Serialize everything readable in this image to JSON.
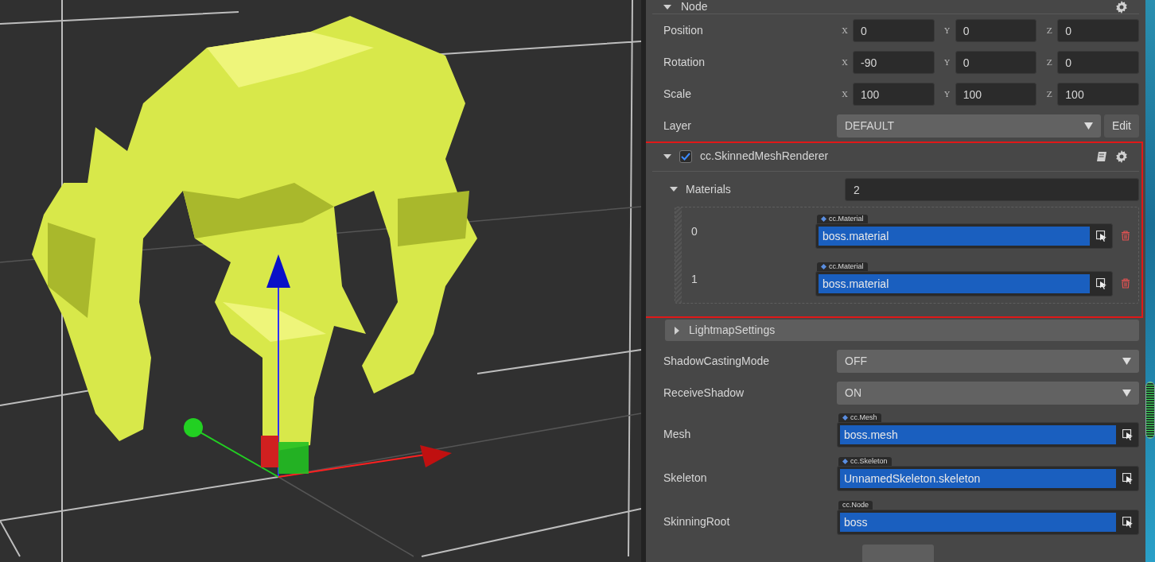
{
  "node": {
    "title": "Node",
    "expanded": true,
    "vectors": [
      {
        "label": "Position",
        "axes": [
          {
            "axis": "X",
            "value": "0"
          },
          {
            "axis": "Y",
            "value": "0"
          },
          {
            "axis": "Z",
            "value": "0"
          }
        ]
      },
      {
        "label": "Rotation",
        "axes": [
          {
            "axis": "X",
            "value": "-90"
          },
          {
            "axis": "Y",
            "value": "0"
          },
          {
            "axis": "Z",
            "value": "0"
          }
        ]
      },
      {
        "label": "Scale",
        "axes": [
          {
            "axis": "X",
            "value": "100"
          },
          {
            "axis": "Y",
            "value": "100"
          },
          {
            "axis": "Z",
            "value": "100"
          }
        ]
      }
    ],
    "layer": {
      "label": "Layer",
      "value": "DEFAULT",
      "button": "Edit"
    }
  },
  "component": {
    "title": "cc.SkinnedMeshRenderer",
    "enabled": true,
    "expanded": true,
    "highlighted": true,
    "materials": {
      "label": "Materials",
      "expanded": true,
      "count": "2",
      "items": [
        {
          "index": "0",
          "type": "cc.Material",
          "value": "boss.material"
        },
        {
          "index": "1",
          "type": "cc.Material",
          "value": "boss.material"
        }
      ]
    },
    "lightmap": {
      "label": "LightmapSettings",
      "expanded": false
    },
    "properties": [
      {
        "kind": "select",
        "label": "ShadowCastingMode",
        "value": "OFF"
      },
      {
        "kind": "select",
        "label": "ReceiveShadow",
        "value": "ON"
      },
      {
        "kind": "asset",
        "label": "Mesh",
        "type": "cc.Mesh",
        "type_icon": true,
        "value": "boss.mesh"
      },
      {
        "kind": "asset",
        "label": "Skeleton",
        "type": "cc.Skeleton",
        "type_icon": true,
        "value": "UnnamedSkeleton.skeleton"
      },
      {
        "kind": "asset",
        "label": "SkinningRoot",
        "type": "cc.Node",
        "type_icon": false,
        "value": "boss"
      }
    ]
  }
}
